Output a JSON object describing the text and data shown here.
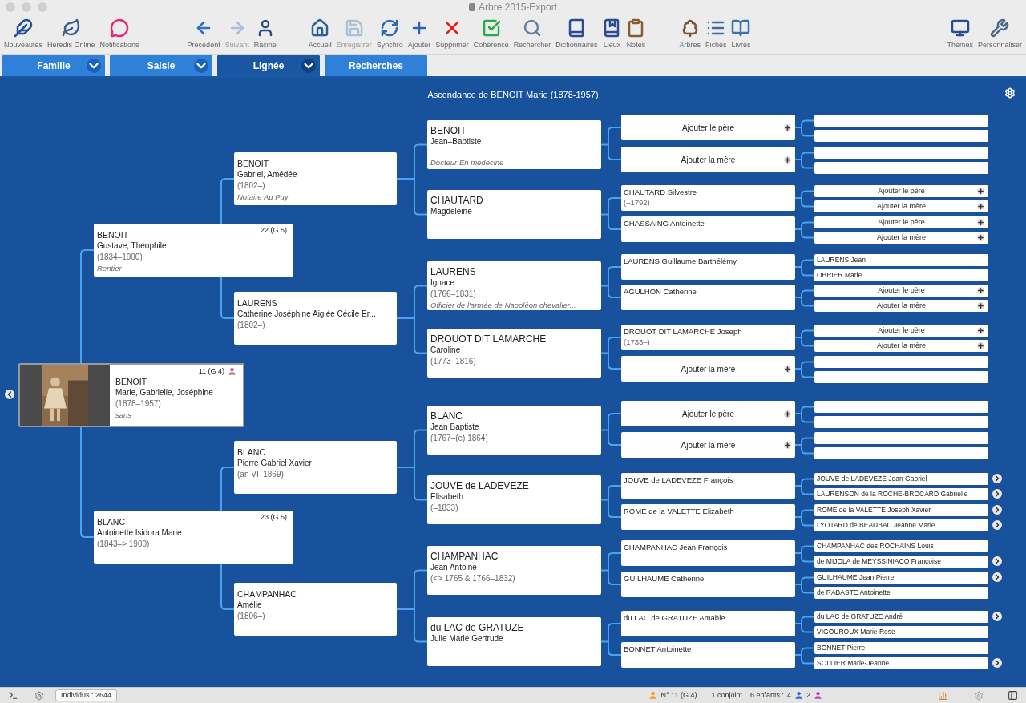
{
  "window": {
    "title": "Arbre 2015-Export"
  },
  "toolbar": {
    "groups": [
      {
        "items": [
          {
            "label": "Nouveautés",
            "disabled": false
          },
          {
            "label": "Heredis Online",
            "disabled": false
          },
          {
            "label": "Notifications",
            "disabled": false
          }
        ]
      },
      {
        "items": [
          {
            "label": "Précédent",
            "disabled": false
          },
          {
            "label": "Suivant",
            "disabled": true
          },
          {
            "label": "Racine",
            "disabled": false
          }
        ]
      },
      {
        "items": [
          {
            "label": "Accueil",
            "disabled": false
          },
          {
            "label": "Enregistrer",
            "disabled": true
          },
          {
            "label": "Synchro",
            "disabled": false
          },
          {
            "label": "Ajouter",
            "disabled": false
          },
          {
            "label": "Supprimer",
            "disabled": false
          },
          {
            "label": "Cohérence",
            "disabled": false
          },
          {
            "label": "Rechercher",
            "disabled": false
          },
          {
            "label": "Dictionnaires",
            "disabled": false
          },
          {
            "label": "Lieux",
            "disabled": false
          },
          {
            "label": "Notes",
            "disabled": false
          }
        ]
      },
      {
        "items": [
          {
            "label": "Arbres",
            "disabled": false
          },
          {
            "label": "Fiches",
            "disabled": false
          },
          {
            "label": "Livres",
            "disabled": false
          }
        ]
      },
      {
        "items": [
          {
            "label": "Thèmes",
            "disabled": false
          },
          {
            "label": "Personnaliser",
            "disabled": false
          }
        ]
      }
    ]
  },
  "tabs": [
    {
      "label": "Famille",
      "selected": false,
      "has_menu": true
    },
    {
      "label": "Saisie",
      "selected": false,
      "has_menu": true
    },
    {
      "label": "Lignée",
      "selected": true,
      "has_menu": true
    },
    {
      "label": "Recherches",
      "selected": false,
      "has_menu": false
    }
  ],
  "tree_title": "Ascendance de BENOIT Marie (1878-1957)",
  "root": {
    "kind": "person",
    "surname": "BENOIT",
    "given": "Marie, Gabrielle, Joséphine",
    "dates": "(1878–1957)",
    "occupation": "sans",
    "number": "11 (G 4)",
    "parents": [
      {
        "kind": "person",
        "surname": "BENOIT",
        "given": "Gustave, Théophile",
        "dates": "(1834–1900)",
        "occupation": "Rentier",
        "number": "22 (G 5)",
        "parents": [
          {
            "kind": "person",
            "surname": "BENOIT",
            "given": "Gabriel, Amédée",
            "dates": "(1802–)",
            "occupation": "Notaire Au Puy",
            "parents": [
              {
                "kind": "person",
                "surname": "BENOIT",
                "given": "Jean–Baptiste",
                "occupation": "Docteur En médecine",
                "parents": [
                  {
                    "kind": "add",
                    "label": "Ajouter le père",
                    "parents": [
                      {
                        "kind": "empty"
                      },
                      {
                        "kind": "empty"
                      }
                    ]
                  },
                  {
                    "kind": "add",
                    "label": "Ajouter la mère",
                    "parents": [
                      {
                        "kind": "empty"
                      },
                      {
                        "kind": "empty"
                      }
                    ]
                  }
                ]
              },
              {
                "kind": "person",
                "surname": "CHAUTARD",
                "given": "Magdeleine",
                "parents": [
                  {
                    "kind": "person",
                    "name": "CHAUTARD Silvestre",
                    "dates": "(–1792)",
                    "parents": [
                      {
                        "kind": "add",
                        "label": "Ajouter le père"
                      },
                      {
                        "kind": "add",
                        "label": "Ajouter la mère"
                      }
                    ]
                  },
                  {
                    "kind": "person",
                    "name": "CHASSAING Antoinette",
                    "parents": [
                      {
                        "kind": "add",
                        "label": "Ajouter le père"
                      },
                      {
                        "kind": "add",
                        "label": "Ajouter la mère"
                      }
                    ]
                  }
                ]
              }
            ]
          },
          {
            "kind": "person",
            "surname": "LAURENS",
            "given": "Catherine Joséphine Aiglée Cécile Er...",
            "dates": "(1802–)",
            "parents": [
              {
                "kind": "person",
                "surname": "LAURENS",
                "given": "Ignace",
                "dates": "(1766–1831)",
                "occupation": "Officier de l'armée de Napoléon chevalier...",
                "parents": [
                  {
                    "kind": "person",
                    "name": "LAURENS Guillaume Barthélémy",
                    "parents": [
                      {
                        "kind": "person",
                        "name": "LAURENS Jean",
                        "more": false
                      },
                      {
                        "kind": "person",
                        "name": "OBRIER Marie",
                        "more": false
                      }
                    ]
                  },
                  {
                    "kind": "person",
                    "name": "AGULHON Catherine",
                    "parents": [
                      {
                        "kind": "add",
                        "label": "Ajouter le père"
                      },
                      {
                        "kind": "add",
                        "label": "Ajouter la mère"
                      }
                    ]
                  }
                ]
              },
              {
                "kind": "person",
                "surname": "DROUOT DIT LAMARCHE",
                "given": "Caroline",
                "dates": "(1773–1816)",
                "parents": [
                  {
                    "kind": "person",
                    "name": "DROUOT DIT LAMARCHE Joseph",
                    "dates": "(1733–)",
                    "parents": [
                      {
                        "kind": "add",
                        "label": "Ajouter le père"
                      },
                      {
                        "kind": "add",
                        "label": "Ajouter la mère"
                      }
                    ]
                  },
                  {
                    "kind": "add",
                    "label": "Ajouter la mère",
                    "parents": [
                      {
                        "kind": "empty"
                      },
                      {
                        "kind": "empty"
                      }
                    ]
                  }
                ]
              }
            ]
          }
        ]
      },
      {
        "kind": "person",
        "surname": "BLANC",
        "given": "Antoinette Isidora Marie",
        "dates": "(1843–> 1900)",
        "number": "23 (G 5)",
        "parents": [
          {
            "kind": "person",
            "surname": "BLANC",
            "given": "Pierre Gabriel Xavier",
            "dates": "(an VI–1869)",
            "parents": [
              {
                "kind": "person",
                "surname": "BLANC",
                "given": "Jean Baptiste",
                "dates": "(1767–(e) 1864)",
                "parents": [
                  {
                    "kind": "add",
                    "label": "Ajouter le père",
                    "parents": [
                      {
                        "kind": "empty"
                      },
                      {
                        "kind": "empty"
                      }
                    ]
                  },
                  {
                    "kind": "add",
                    "label": "Ajouter la mère",
                    "parents": [
                      {
                        "kind": "empty"
                      },
                      {
                        "kind": "empty"
                      }
                    ]
                  }
                ]
              },
              {
                "kind": "person",
                "surname": "JOUVE de LADEVEZE",
                "given": "Elisabeth",
                "dates": "(–1833)",
                "parents": [
                  {
                    "kind": "person",
                    "name": "JOUVE de LADEVEZE François",
                    "parents": [
                      {
                        "kind": "person",
                        "name": "JOUVE de LADEVEZE Jean Gabriel",
                        "more": true
                      },
                      {
                        "kind": "person",
                        "name": "LAURENSON de la ROCHE-BROCARD Gabrielle",
                        "more": true
                      }
                    ]
                  },
                  {
                    "kind": "person",
                    "name": "ROME de la VALETTE Elizabeth",
                    "parents": [
                      {
                        "kind": "person",
                        "name": "ROME de la VALETTE Joseph Xavier",
                        "more": true
                      },
                      {
                        "kind": "person",
                        "name": "LYOTARD de BEAUBAC Jeanne Marie",
                        "more": true
                      }
                    ]
                  }
                ]
              }
            ]
          },
          {
            "kind": "person",
            "surname": "CHAMPANHAC",
            "given": "Amélie",
            "dates": "(1806–)",
            "parents": [
              {
                "kind": "person",
                "surname": "CHAMPANHAC",
                "given": "Jean Antoine",
                "dates": "(<> 1765 & 1766–1832)",
                "parents": [
                  {
                    "kind": "person",
                    "name": "CHAMPANHAC Jean François",
                    "parents": [
                      {
                        "kind": "person",
                        "name": "CHAMPANHAC des ROCHAINS Louis",
                        "more": false
                      },
                      {
                        "kind": "person",
                        "name": "de MIJOLA de MEYSSINIACO Françoise",
                        "more": true
                      }
                    ]
                  },
                  {
                    "kind": "person",
                    "name": "GUILHAUME Catherine",
                    "parents": [
                      {
                        "kind": "person",
                        "name": "GUILHAUME Jean Pierre",
                        "more": true
                      },
                      {
                        "kind": "person",
                        "name": "de RABASTE Antoinette",
                        "more": false
                      }
                    ]
                  }
                ]
              },
              {
                "kind": "person",
                "surname": "du LAC de GRATUZE",
                "given": "Julie Marie Gertrude",
                "parents": [
                  {
                    "kind": "person",
                    "name": "du LAC de GRATUZE Amable",
                    "parents": [
                      {
                        "kind": "person",
                        "name": "du LAC de GRATUZE André",
                        "more": true
                      },
                      {
                        "kind": "person",
                        "name": "VIGOUROUX Marie Rose",
                        "more": false
                      }
                    ]
                  },
                  {
                    "kind": "person",
                    "name": "BONNET Antoinette",
                    "parents": [
                      {
                        "kind": "person",
                        "name": "BONNET Pierre",
                        "more": false
                      },
                      {
                        "kind": "person",
                        "name": "SOLLIER Marie-Jeanne",
                        "more": true
                      }
                    ]
                  }
                ]
              }
            ]
          }
        ]
      }
    ]
  },
  "status_bar": {
    "individuals": "Individus : 2644",
    "number": "N° 11 (G 4)",
    "spouses": "1 conjoint",
    "children_label": "6 enfants :",
    "sons": "4",
    "daughters": "2"
  }
}
